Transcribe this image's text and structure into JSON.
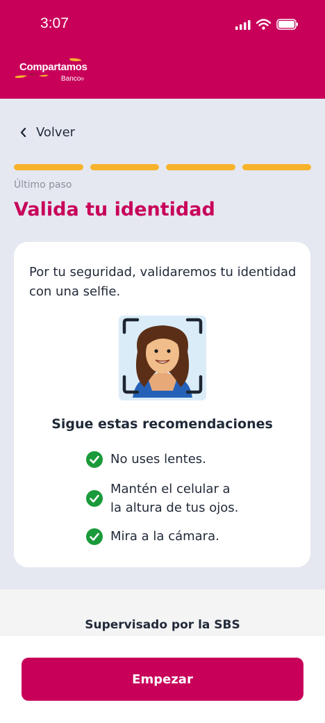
{
  "status": {
    "time": "3:07"
  },
  "brand": {
    "name": "Compartamos",
    "subname": "Banco",
    "registered": "®"
  },
  "nav": {
    "back_label": "Volver"
  },
  "progress": {
    "completed": 4,
    "total": 4
  },
  "step": {
    "label": "Último paso"
  },
  "page": {
    "title": "Valida tu identidad"
  },
  "card": {
    "description": "Por tu seguridad, validaremos tu identidad con una selfie.",
    "recommendations_title": "Sigue estas recomendaciones",
    "recommendations": [
      {
        "line1": "No uses lentes.",
        "line2": ""
      },
      {
        "line1": "Mantén el celular a",
        "line2": "la altura de tus ojos."
      },
      {
        "line1": "Mira a la cámara.",
        "line2": ""
      }
    ]
  },
  "footer": {
    "supervision": "Supervisado por la SBS"
  },
  "actions": {
    "start_label": "Empezar"
  },
  "colors": {
    "brand": "#c8005a",
    "accent": "#f7b32b",
    "success": "#1a9a3a"
  }
}
